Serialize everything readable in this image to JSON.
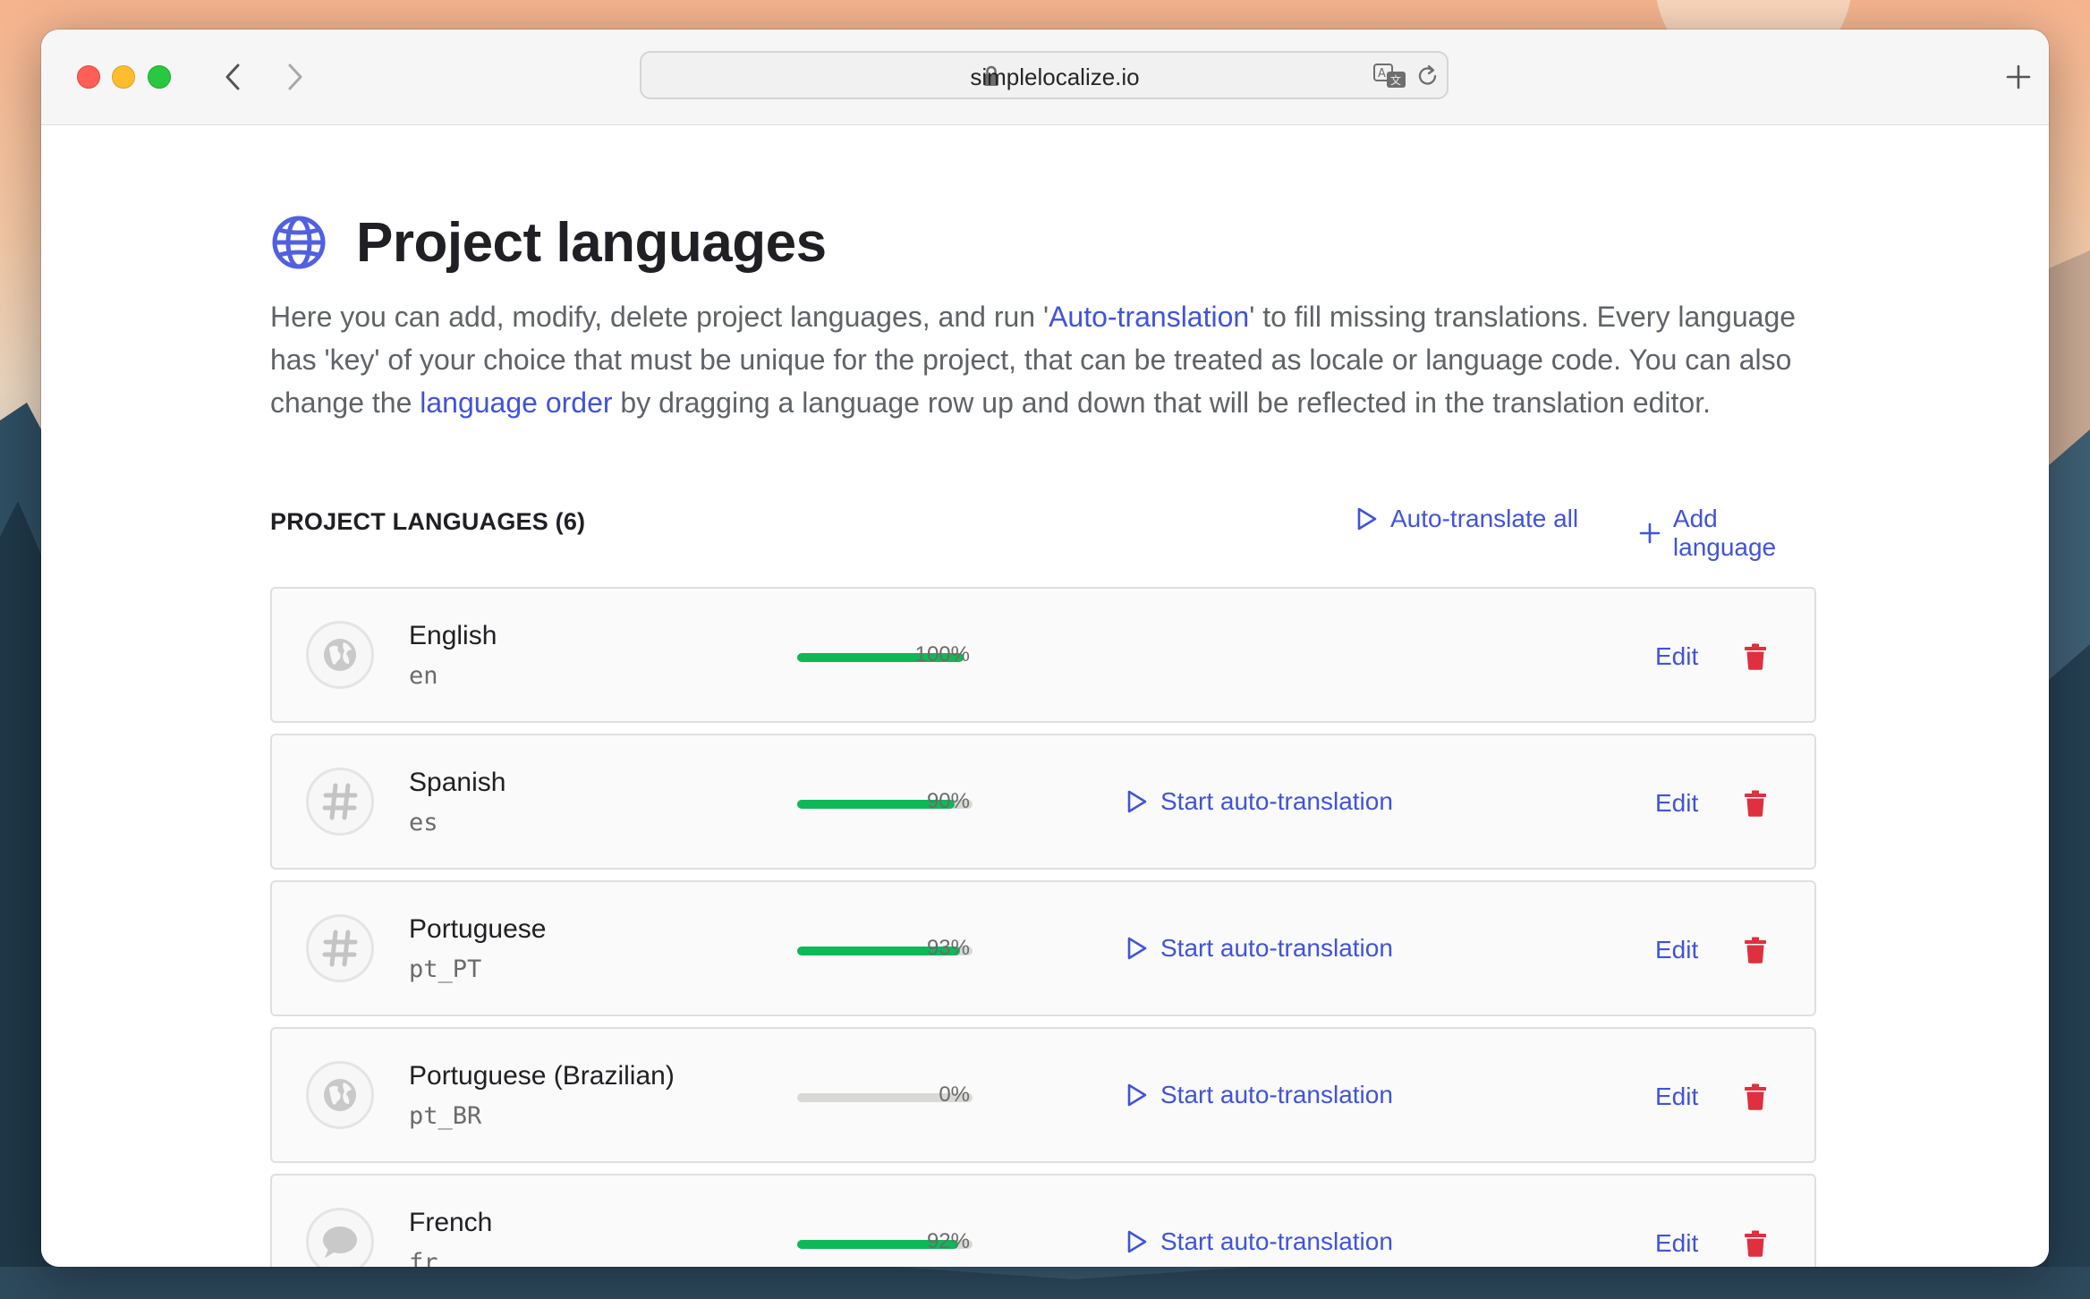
{
  "browser": {
    "url": "simplelocalize.io"
  },
  "page": {
    "title": "Project languages",
    "description_parts": {
      "p1": "Here you can add, modify, delete project languages, and run '",
      "link1": "Auto-translation",
      "p2": "' to fill missing translations. Every language has 'key' of your choice that must be unique for the project, that can be treated as locale or language code. You can also change the ",
      "link2": "language order",
      "p3": " by dragging a language row up and down that will be reflected in the translation editor."
    }
  },
  "section": {
    "title": "PROJECT LANGUAGES (6)",
    "auto_translate_all": "Auto-translate all",
    "add_language": "Add language"
  },
  "languages": [
    {
      "name": "English",
      "code": "en",
      "progress": 100,
      "progress_label": "100%",
      "icon": "globe-icon",
      "auto_label": "",
      "edit_label": "Edit"
    },
    {
      "name": "Spanish",
      "code": "es",
      "progress": 90,
      "progress_label": "90%",
      "icon": "hash-icon",
      "auto_label": "Start auto-translation",
      "edit_label": "Edit"
    },
    {
      "name": "Portuguese",
      "code": "pt_PT",
      "progress": 93,
      "progress_label": "93%",
      "icon": "hash-icon",
      "auto_label": "Start auto-translation",
      "edit_label": "Edit"
    },
    {
      "name": "Portuguese (Brazilian)",
      "code": "pt_BR",
      "progress": 0,
      "progress_label": "0%",
      "icon": "globe-icon",
      "auto_label": "Start auto-translation",
      "edit_label": "Edit"
    },
    {
      "name": "French",
      "code": "fr",
      "progress": 92,
      "progress_label": "92%",
      "icon": "speech-bubble-icon",
      "auto_label": "Start auto-translation",
      "edit_label": "Edit"
    }
  ],
  "colors": {
    "accent": "#4153d8",
    "progress": "#0fb857",
    "danger": "#e02f3e"
  }
}
